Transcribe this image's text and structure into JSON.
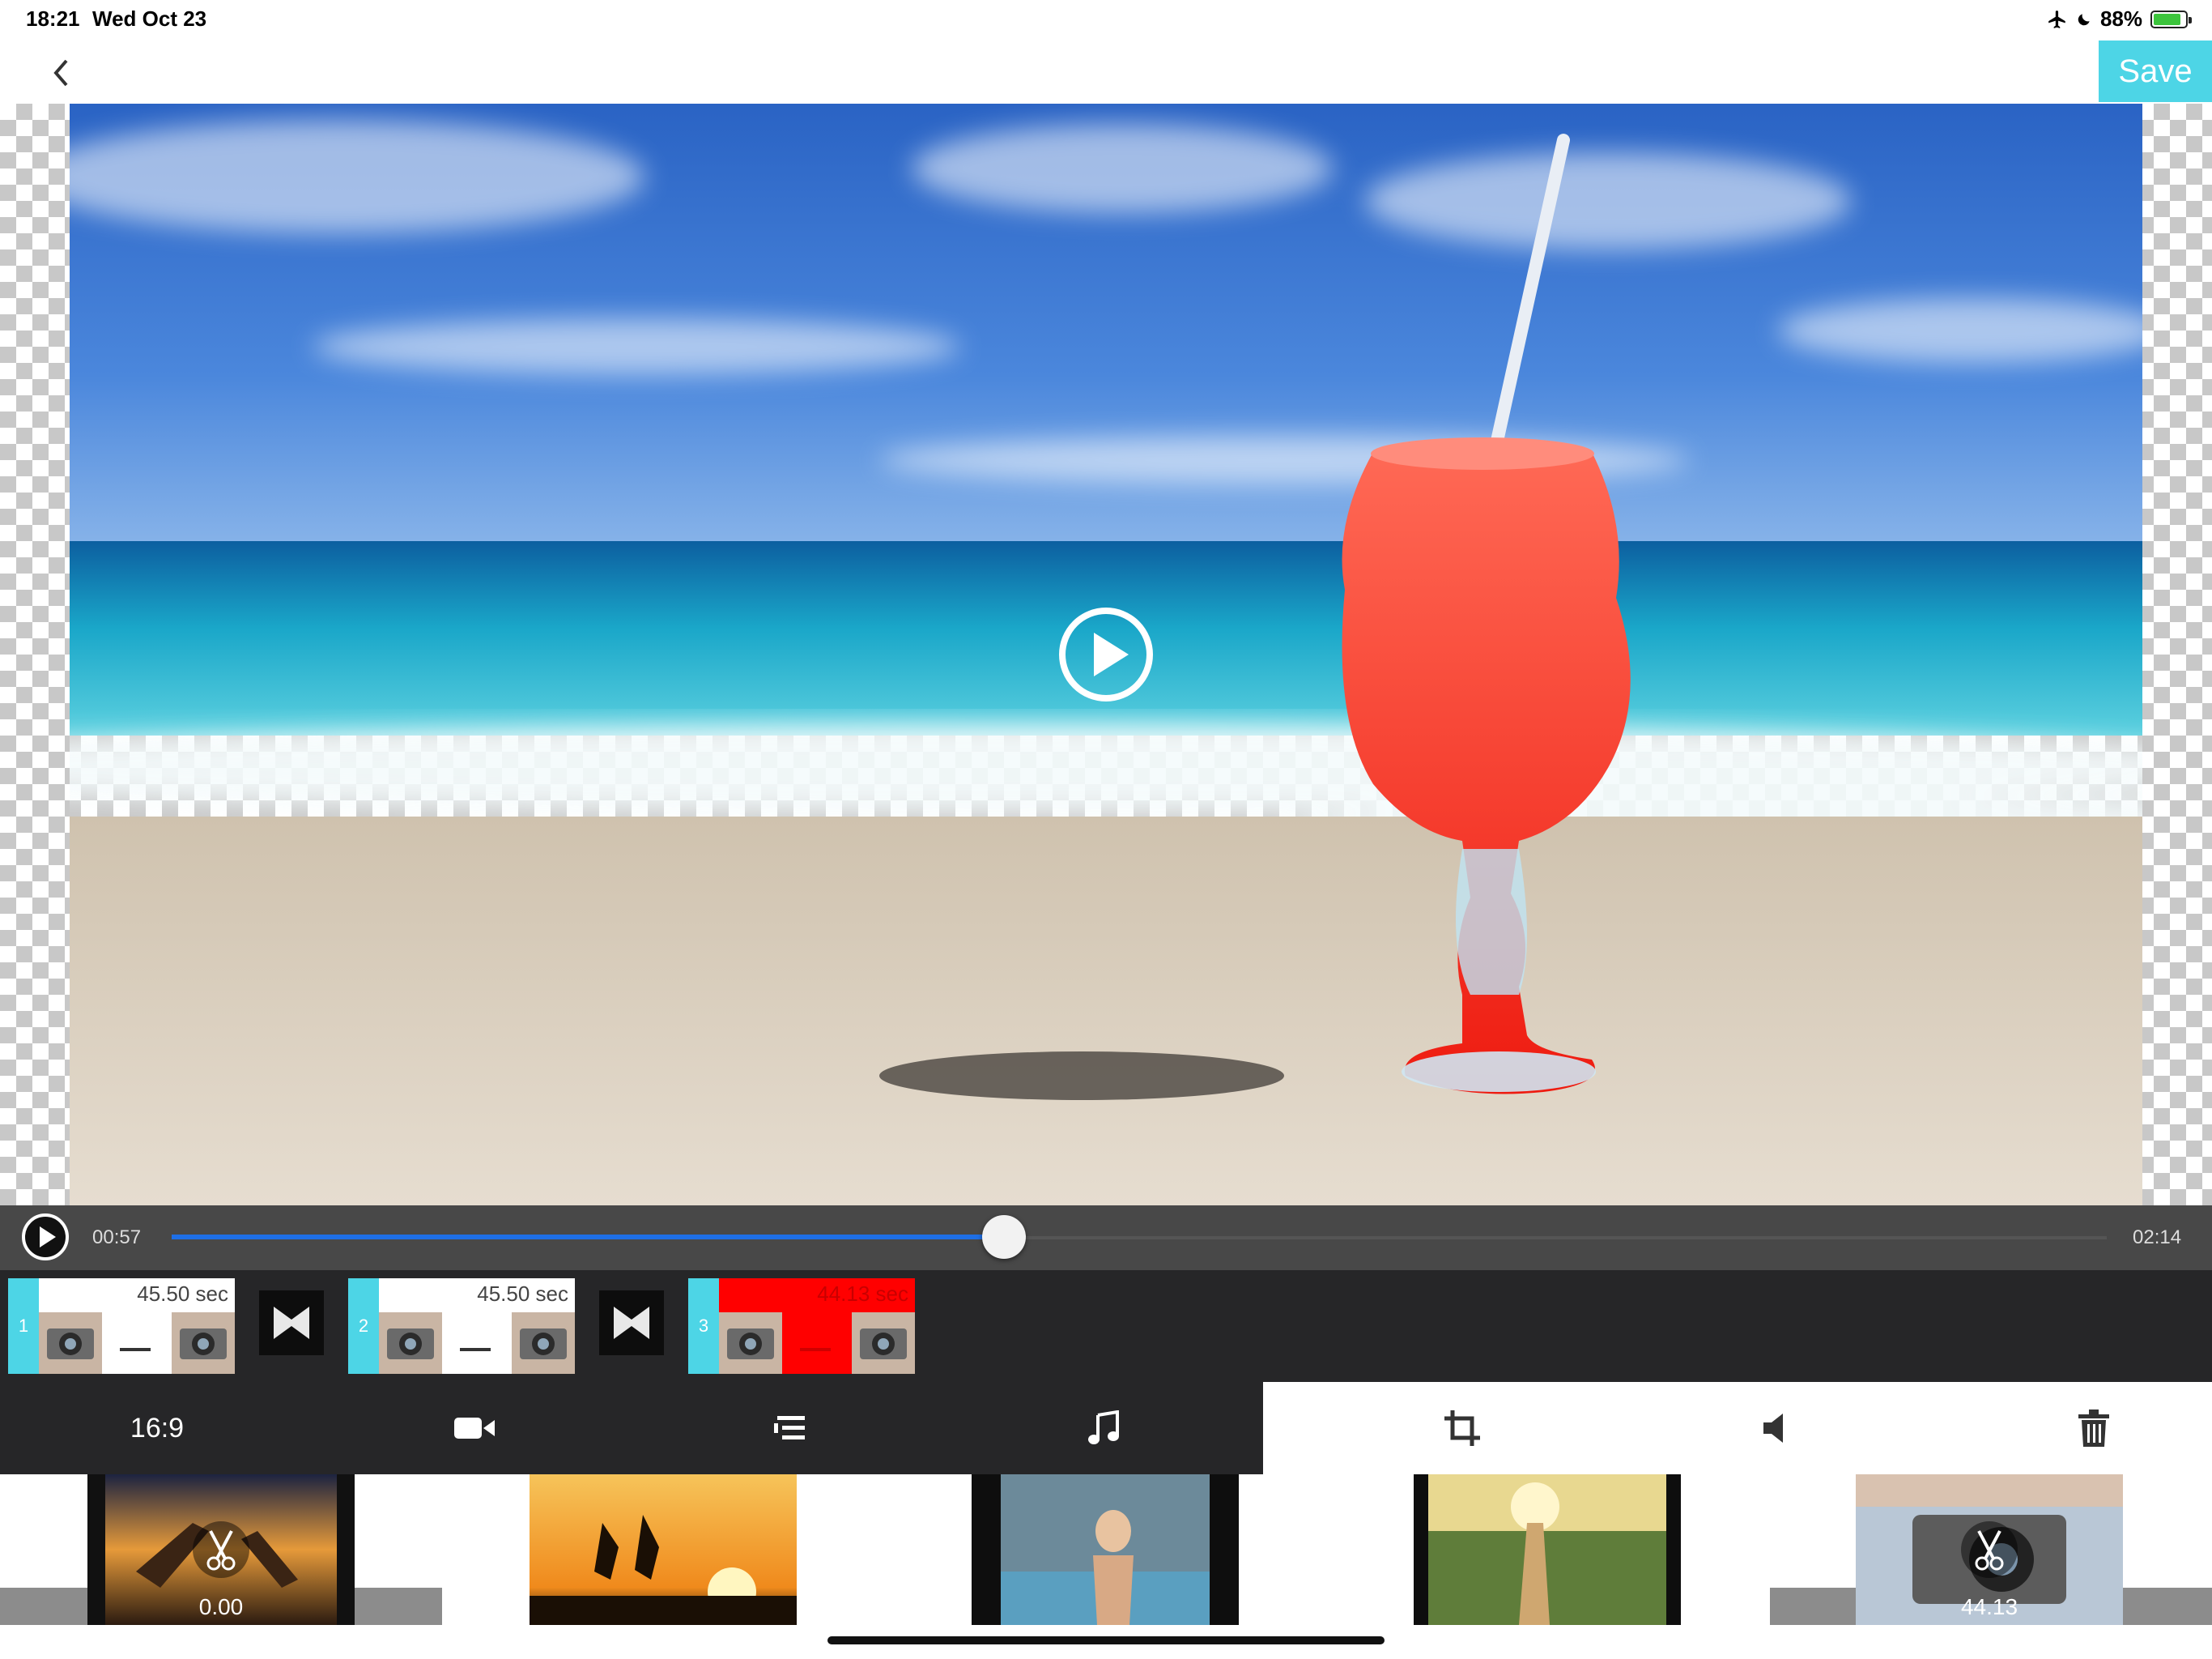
{
  "status_bar": {
    "time": "18:21",
    "date": "Wed Oct 23",
    "battery_percent": "88%",
    "battery_level": 0.88,
    "icons": [
      "airplane-icon",
      "moon-icon",
      "battery-charging-icon"
    ]
  },
  "nav": {
    "back_icon": "chevron-left-icon",
    "save_label": "Save"
  },
  "colors": {
    "accent": "#4dd5e6",
    "progress": "#1e6fe6",
    "selected_clip": "#ff0000",
    "dark_panel": "#262628"
  },
  "player": {
    "current_time": "00:57",
    "total_time": "02:14",
    "progress": 0.43
  },
  "clips": [
    {
      "index": "1",
      "duration": "45.50 sec",
      "selected": false
    },
    {
      "index": "2",
      "duration": "45.50 sec",
      "selected": false
    },
    {
      "index": "3",
      "duration": "44.13 sec",
      "selected": true
    }
  ],
  "toolbar": {
    "aspect_ratio": "16:9",
    "tools": [
      "video-camera-icon",
      "align-icon",
      "music-note-icon",
      "crop-icon",
      "speaker-icon",
      "trash-icon"
    ]
  },
  "filmstrip": {
    "start_label": "0.00",
    "end_label": "44.13"
  }
}
